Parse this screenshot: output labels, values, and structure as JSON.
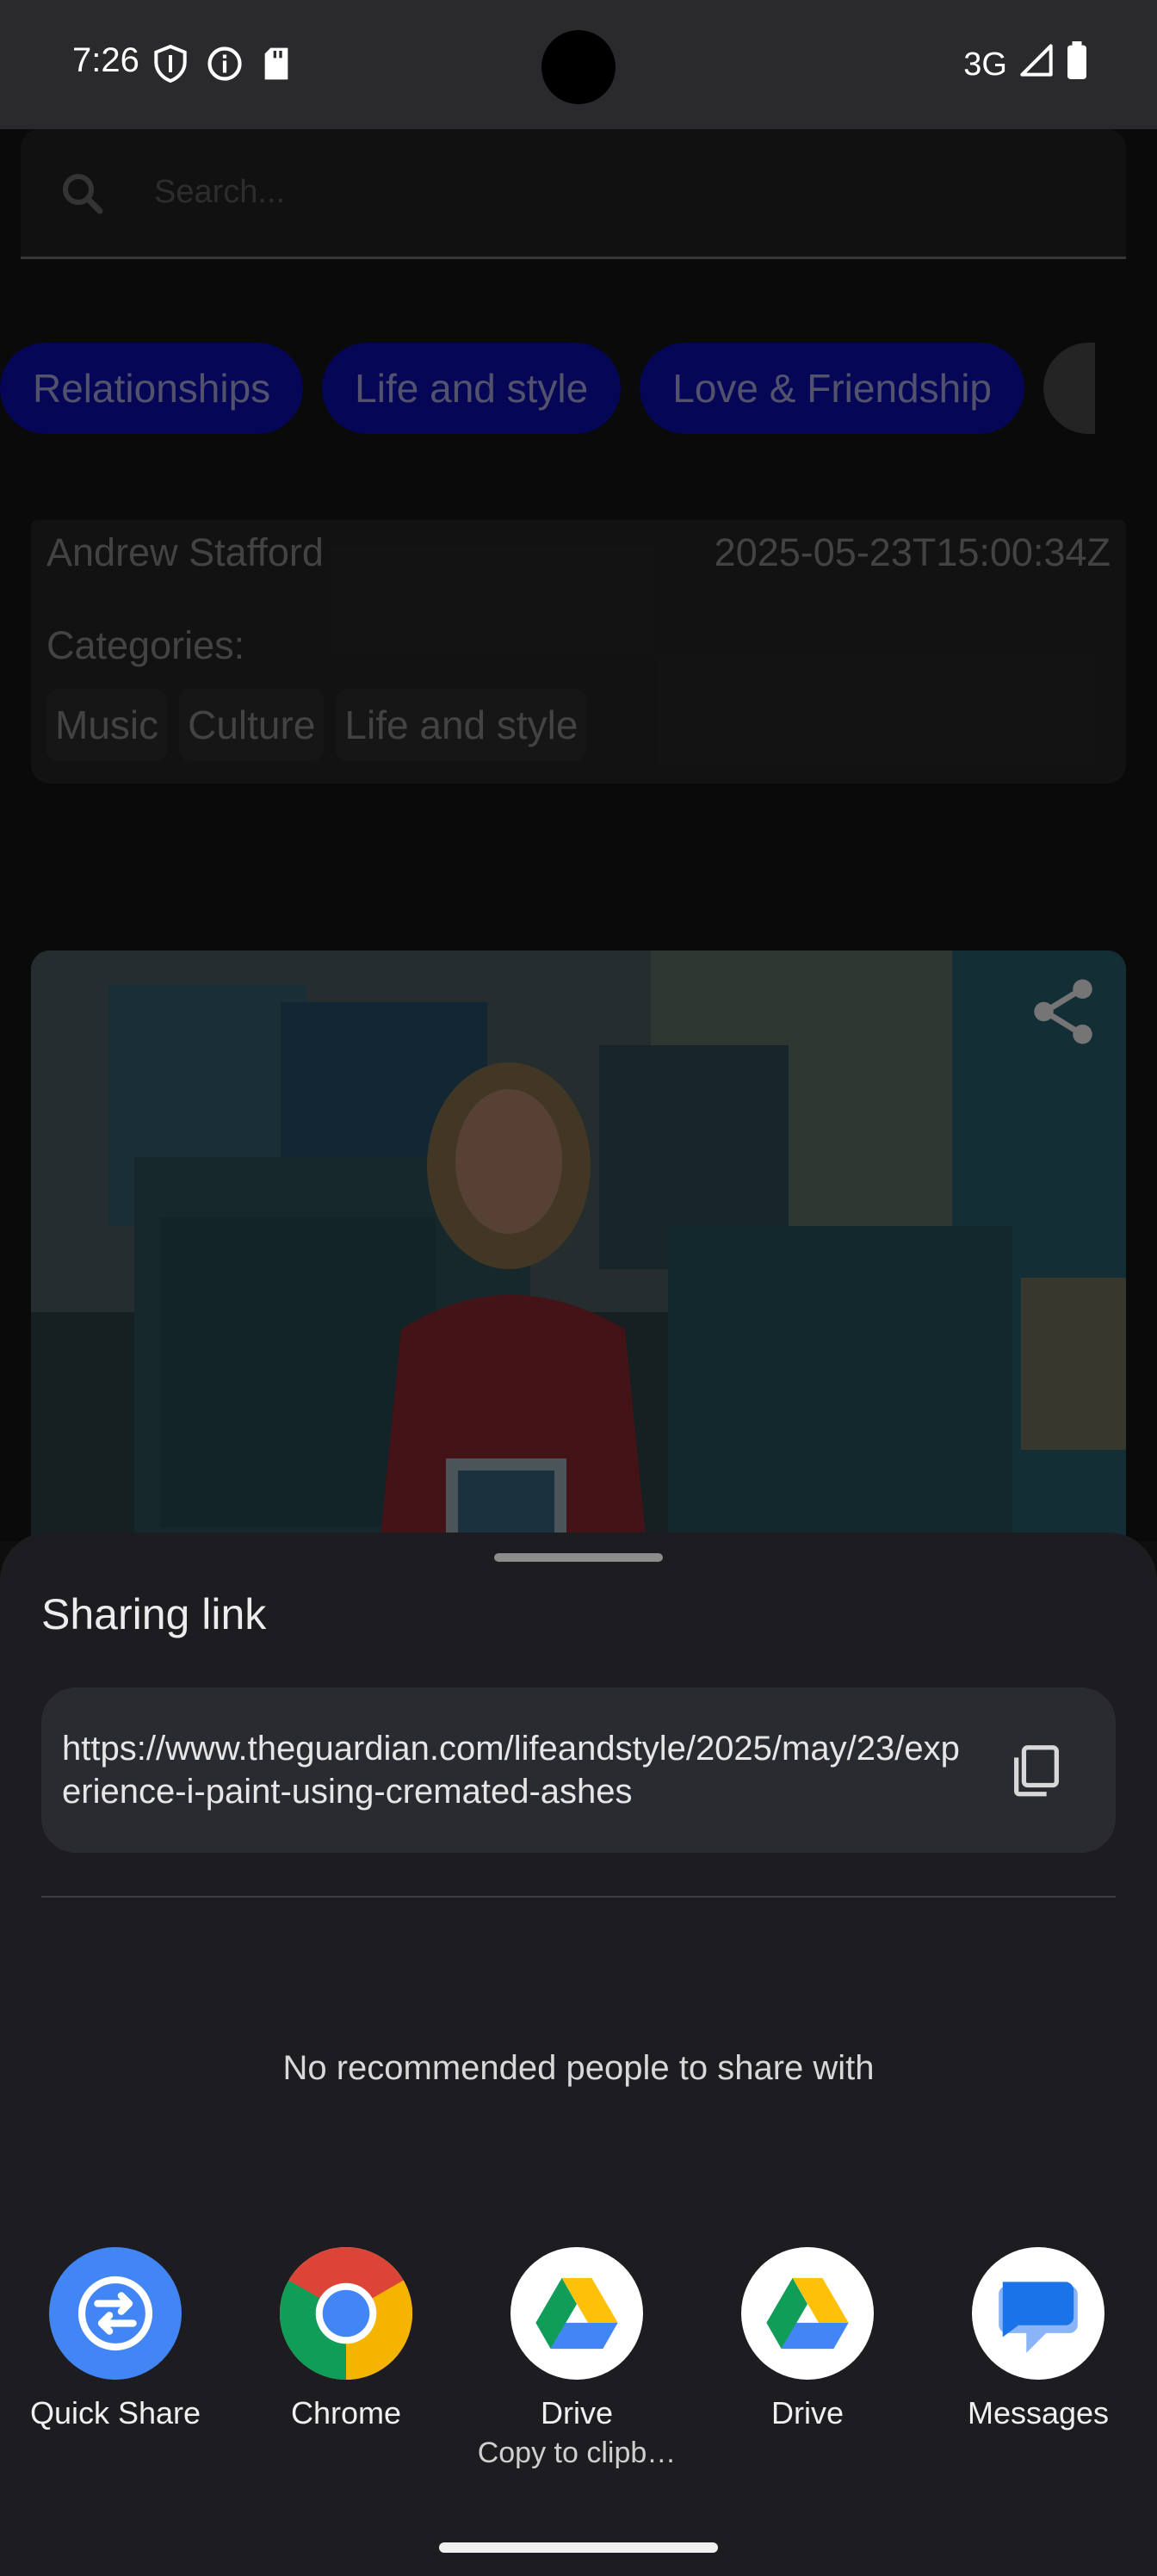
{
  "status_bar": {
    "time": "7:26",
    "network": "3G",
    "icons_left": [
      "shield-icon",
      "info-icon",
      "sd-card-icon"
    ],
    "icons_right": [
      "signal-icon",
      "battery-icon"
    ]
  },
  "search": {
    "placeholder": "Search..."
  },
  "chips": [
    "Relationships",
    "Life and style",
    "Love & Friendship"
  ],
  "article": {
    "author": "Andrew Stafford",
    "date": "2025-05-23T15:00:34Z",
    "categories_label": "Categories:",
    "tags": [
      "Music",
      "Culture",
      "Life and style"
    ]
  },
  "share_sheet": {
    "title": "Sharing link",
    "url": "https://www.theguardian.com/lifeandstyle/2025/may/23/experience-i-paint-using-cremated-ashes",
    "no_people": "No recommended people to share with",
    "targets": [
      {
        "label": "Quick Share",
        "icon": "quick-share-icon",
        "sub": ""
      },
      {
        "label": "Chrome",
        "icon": "chrome-icon",
        "sub": ""
      },
      {
        "label": "Drive",
        "icon": "drive-icon",
        "sub": "Copy to clipb…"
      },
      {
        "label": "Drive",
        "icon": "drive-icon",
        "sub": ""
      },
      {
        "label": "Messages",
        "icon": "messages-icon",
        "sub": ""
      }
    ]
  },
  "colors": {
    "chip_bg": "#0a0a8c",
    "sheet_bg": "#1d1d21",
    "quick_share_blue": "#4285f4"
  }
}
